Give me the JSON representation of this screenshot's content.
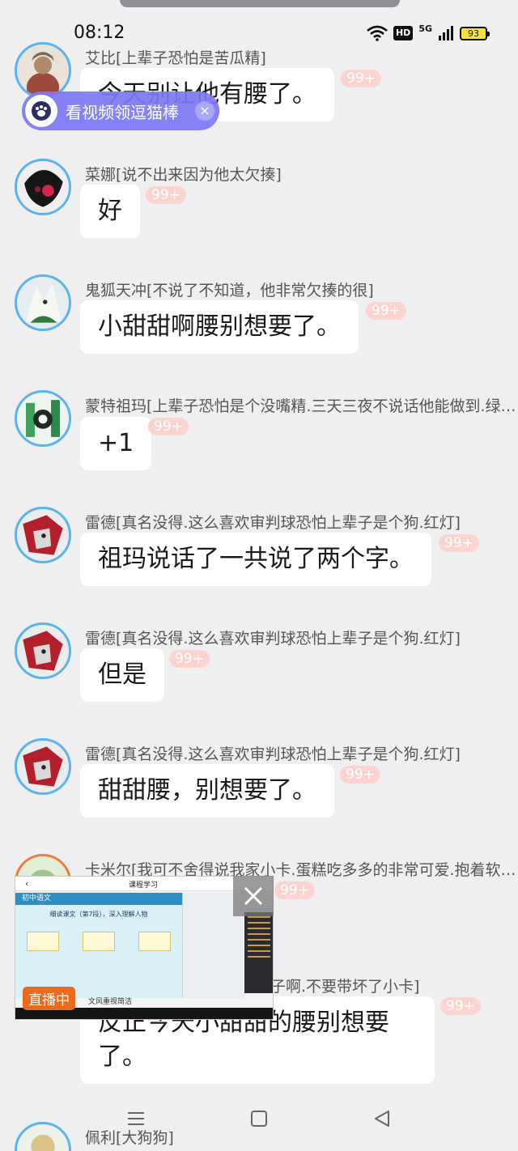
{
  "status_bar": {
    "time": "08:12",
    "hd_label": "HD",
    "network_label": "5G",
    "battery_level": "93"
  },
  "promo": {
    "text": "看视频领逗猫棒",
    "close_glyph": "×"
  },
  "messages": [
    {
      "sender": "艾比[上辈子恐怕是苦瓜精]",
      "text": "今天别让他有腰了。",
      "badge": "99+"
    },
    {
      "sender": "菜娜[说不出来因为他太欠揍]",
      "text": "好",
      "badge": "99+"
    },
    {
      "sender": "鬼狐天冲[不说了不知道，他非常欠揍的很]",
      "text": "小甜甜啊腰别想要了。",
      "badge": "99+"
    },
    {
      "sender": "蒙特祖玛[上辈子恐怕是个没嘴精.三天三夜不说话他能做到.绿…",
      "text": "+1",
      "badge": "99+"
    },
    {
      "sender": "雷德[真名没得.这么喜欢审判球恐怕上辈子是个狗.红灯]",
      "text": "祖玛说话了一共说了两个字。",
      "badge": "99+"
    },
    {
      "sender": "雷德[真名没得.这么喜欢审判球恐怕上辈子是个狗.红灯]",
      "text": "但是",
      "badge": "99+"
    },
    {
      "sender": "雷德[真名没得.这么喜欢审判球恐怕上辈子是个狗.红灯]",
      "text": "甜甜腰，别想要了。",
      "badge": "99+"
    },
    {
      "sender": "卡米尔[我可不舍得说我家小卡.蛋糕吃多多的非常可爱.抱着软…",
      "text": "",
      "badge": "99+"
    },
    {
      "sender": "子啊.不要带坏了小卡]",
      "text": "反正今天小甜甜的腰别想要了。",
      "badge": "99+"
    },
    {
      "sender": "佩利[大狗狗]",
      "text": "",
      "badge": ""
    }
  ],
  "live_window": {
    "label": "直播中",
    "title": "课程学习",
    "slide_header": "初中语文",
    "slide_subtitle": "细读课文（第7段），深入理解人物",
    "slide_footer": "文风重视简洁"
  },
  "colors": {
    "background": "#efeff1",
    "bubble": "#ffffff",
    "avatar_ring": "#5ab3ee",
    "badge": "#fbd3d0",
    "promo": "#7e79f6",
    "live_label": "#ec6a1e"
  },
  "nav": {
    "items": [
      "menu-icon",
      "home-icon",
      "back-icon"
    ]
  }
}
